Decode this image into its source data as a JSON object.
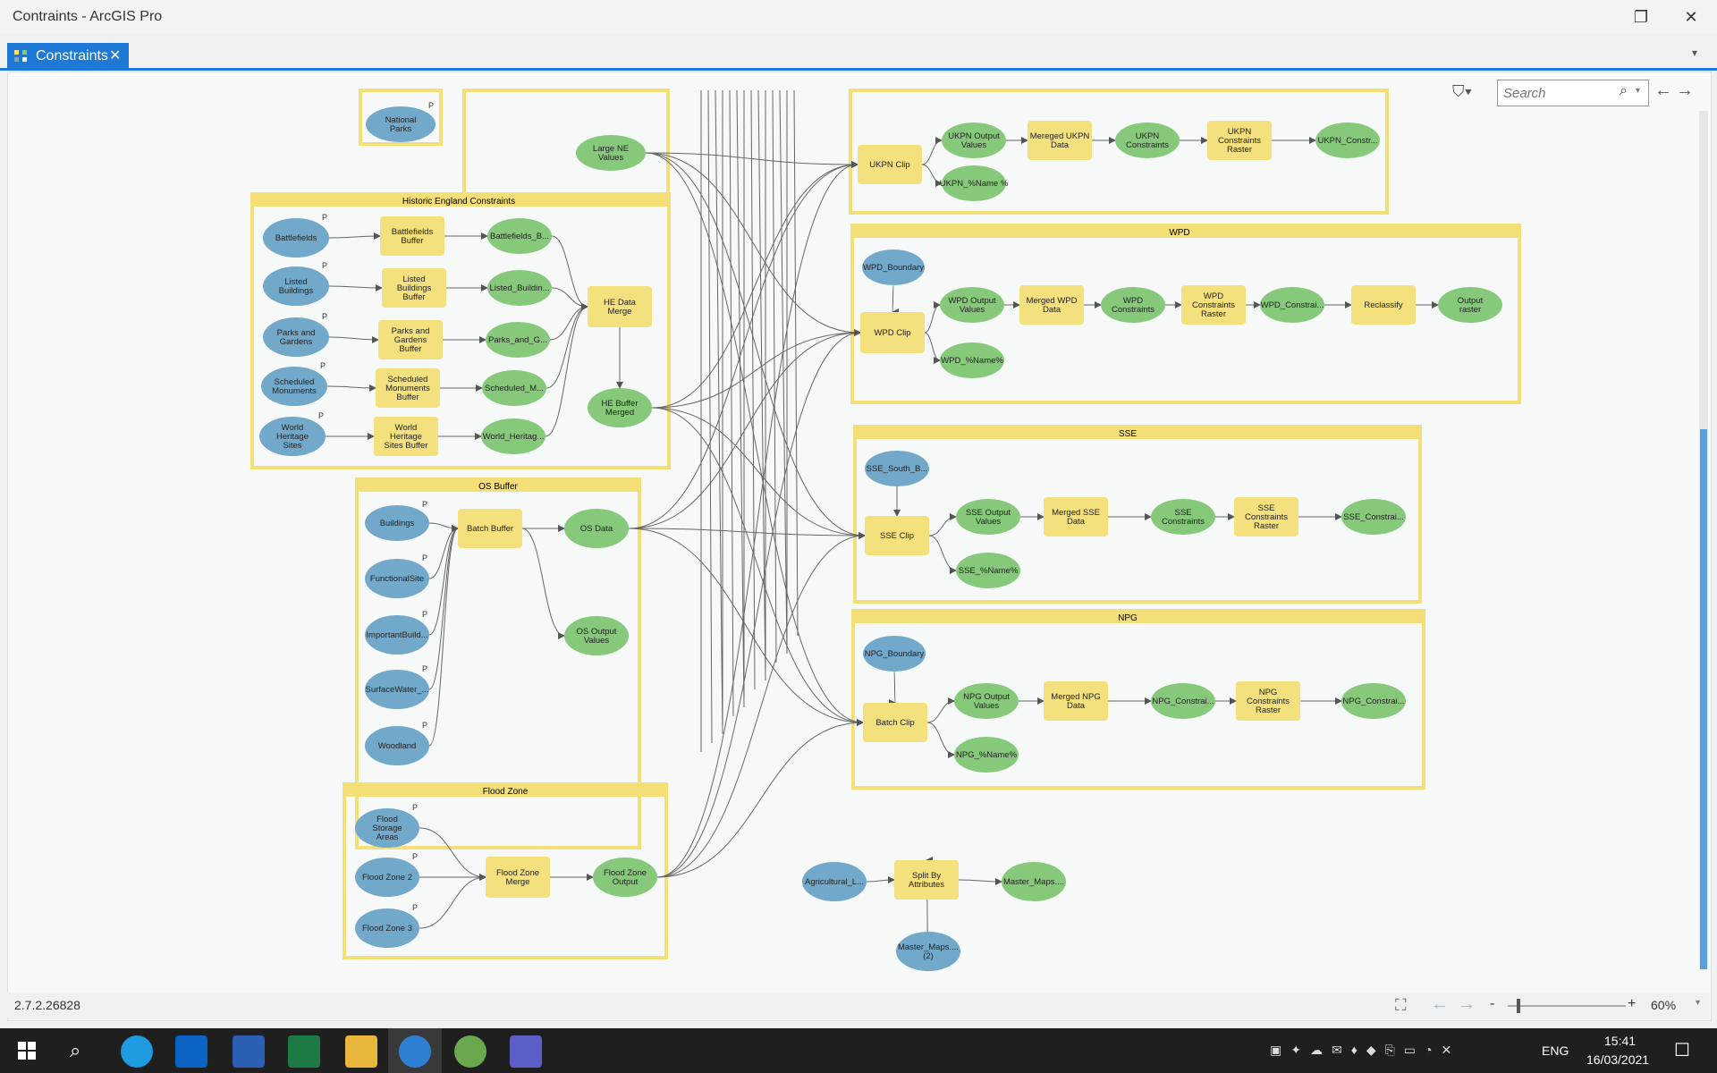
{
  "window": {
    "title": "Contraints - ArcGIS Pro"
  },
  "tab": {
    "label": "Constraints"
  },
  "search": {
    "placeholder": "Search"
  },
  "status": {
    "version": "2.7.2.26828",
    "zoom": "60%"
  },
  "taskbar": {
    "lang": "ENG",
    "time": "15:41",
    "date": "16/03/2021"
  },
  "colors": {
    "data": "#72a9cb",
    "tool": "#f4e07c",
    "output": "#86c97a",
    "group": "#f3df75",
    "accent": "#1d78d6"
  },
  "groups": {
    "historic": "Historic England Constraints",
    "osbuffer": "OS Buffer",
    "flood": "Flood Zone",
    "wpd": "WPD",
    "sse": "SSE",
    "npg": "NPG"
  },
  "nodes": {
    "national_parks": "National Parks",
    "large_ne": "Large NE Values",
    "battlefields": "Battlefields",
    "battlefields_buffer": "Battlefields Buffer",
    "battlefields_b": "Battlefields_B...",
    "listed": "Listed Buildings",
    "listed_buffer": "Listed Buildings Buffer",
    "listed_b": "Listed_Buildin...",
    "parks": "Parks and Gardens",
    "parks_buffer": "Parks and Gardens Buffer",
    "parks_g": "Parks_and_G...",
    "sched": "Scheduled Monuments",
    "sched_buffer": "Scheduled Monuments Buffer",
    "sched_m": "Scheduled_M...",
    "whs": "World Heritage Sites",
    "whs_buffer": "World Heritage Sites Buffer",
    "whs_h": "World_Heritag...",
    "he_merge": "HE Data Merge",
    "he_buffer_merged": "HE Buffer Merged",
    "buildings": "Buildings",
    "functional": "FunctionalSite",
    "important": "ImportantBuild...",
    "surfacewater": "SurfaceWater_...",
    "woodland": "Woodland",
    "batch_buffer": "Batch Buffer",
    "os_data": "OS Data",
    "os_output": "OS Output Values",
    "flood_storage": "Flood Storage Areas",
    "flood2": "Flood Zone 2",
    "flood3": "Flood Zone 3",
    "flood_merge": "Flood Zone Merge",
    "flood_output": "Flood Zone Output",
    "ukpn_clip": "UKPN Clip",
    "ukpn_out": "UKPN Output Values",
    "ukpn_merged": "Mereged UKPN Data",
    "ukpn_cons": "UKPN Constraints",
    "ukpn_raster": "UKPN Constraints Raster",
    "ukpn_constr": "UKPN_Constr...",
    "ukpn_name": "UKPN_%Name %",
    "wpd_boundary": "WPD_Boundary",
    "wpd_clip": "WPD Clip",
    "wpd_out": "WPD Output Values",
    "wpd_merged": "Merged WPD Data",
    "wpd_cons": "WPD Constraints",
    "wpd_raster": "WPD Constraints Raster",
    "wpd_constrai": "WPD_Constrai...",
    "reclassify": "Reclassify",
    "output_raster": "Output raster",
    "wpd_name": "WPD_%Name%",
    "sse_south": "SSE_South_B...",
    "sse_clip": "SSE Clip",
    "sse_out": "SSE Output Values",
    "sse_merged": "Merged SSE Data",
    "sse_cons": "SSE Constraints",
    "sse_raster": "SSE Constraints Raster",
    "sse_constrai": "SSE_Constrai...",
    "sse_name": "SSE_%Name%",
    "npg_boundary": "NPG_Boundary",
    "batch_clip": "Batch Clip",
    "npg_out": "NPG Output Values",
    "npg_merged": "Merged NPG Data",
    "npg_constrai": "NPG_Constrai...",
    "npg_raster": "NPG Constraints Raster",
    "npg_constrai2": "NPG_Constrai...",
    "npg_name": "NPG_%Name%",
    "agri": "Agricultural_L...",
    "split": "Split By Attributes",
    "master": "Master_Maps....",
    "master2": "Master_Maps.... (2)"
  },
  "param_marker": "P"
}
